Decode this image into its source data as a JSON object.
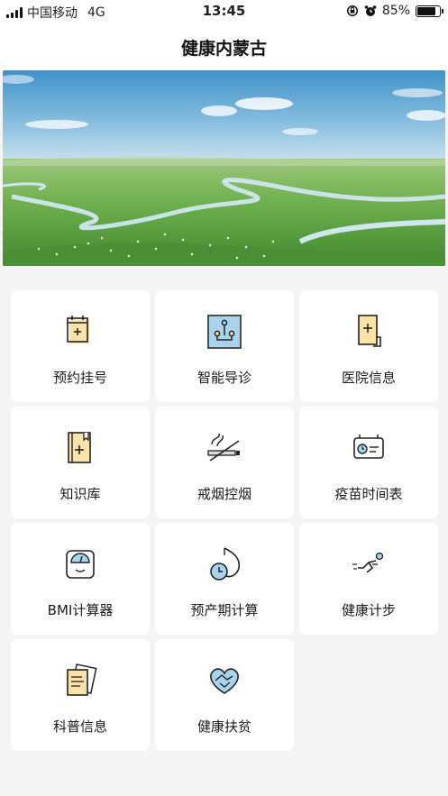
{
  "status_bar": {
    "carrier": "中国移动",
    "network": "4G",
    "time": "13:45",
    "battery_percent": "85%",
    "battery_level": 0.85,
    "icons": [
      "signal-icon",
      "rotation-lock-icon",
      "alarm-icon",
      "battery-icon"
    ]
  },
  "header": {
    "title": "健康内蒙古"
  },
  "banner": {
    "image": "grassland-river-landscape"
  },
  "services": [
    {
      "label": "预约挂号",
      "icon": "calendar-plus-icon"
    },
    {
      "label": "智能导诊",
      "icon": "smart-guide-icon"
    },
    {
      "label": "医院信息",
      "icon": "hospital-info-icon"
    },
    {
      "label": "知识库",
      "icon": "book-plus-icon"
    },
    {
      "label": "戒烟控烟",
      "icon": "smoking-icon"
    },
    {
      "label": "疫苗时间表",
      "icon": "vaccine-schedule-icon"
    },
    {
      "label": "BMI计算器",
      "icon": "scale-icon"
    },
    {
      "label": "预产期计算",
      "icon": "pregnancy-clock-icon"
    },
    {
      "label": "健康计步",
      "icon": "running-icon"
    },
    {
      "label": "科普信息",
      "icon": "documents-icon"
    },
    {
      "label": "健康扶贫",
      "icon": "heart-hands-icon"
    }
  ],
  "colors": {
    "accent_yellow": "#f6d58c",
    "accent_blue": "#a7d4ec",
    "icon_stroke": "#222222",
    "background": "#f4f4f4"
  }
}
